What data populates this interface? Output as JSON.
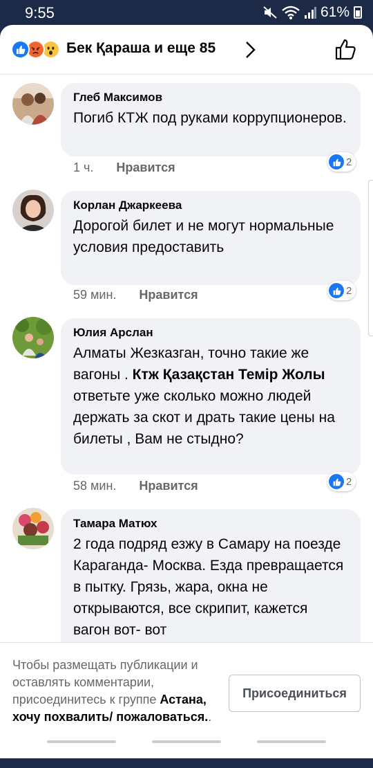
{
  "status_bar": {
    "time": "9:55",
    "battery": "61%",
    "icons": [
      "mute-icon",
      "wifi-icon",
      "signal-icon",
      "battery-icon"
    ]
  },
  "header": {
    "title": "Бек Қараша и еще 85",
    "reactions": [
      "like-reaction-icon",
      "angry-reaction-icon",
      "wow-reaction-icon"
    ]
  },
  "comments": [
    {
      "author": "Глеб Максимов",
      "text": "Погиб КТЖ под руками коррупционеров.",
      "time": "1 ч.",
      "like_label": "Нравится",
      "reaction_count": "2"
    },
    {
      "author": "Корлан Джаркеева",
      "text": "Дорогой билет и не могут нормальные условия предоставить",
      "time": "59 мин.",
      "like_label": "Нравится",
      "reaction_count": "2"
    },
    {
      "author": "Юлия Арслан",
      "text_before": "Алматы Жезказган, точно такие же вагоны . ",
      "mention": "Ктж Қазақстан Темір Жолы",
      "text_after": " ответьте уже сколько можно людей держать за скот и драть такие цены на билеты , Вам не стыдно?",
      "time": "58 мин.",
      "like_label": "Нравится",
      "reaction_count": "2"
    },
    {
      "author": "Тамара Матюх",
      "text": "2 года подряд езжу в Самару на поезде Караганда- Москва. Езда превращается в пытку. Грязь, жара, окна не открываются, все скрипит, кажется вагон вот- вот"
    }
  ],
  "join": {
    "text": "Чтобы размещать публикации и оставлять комментарии, присоединитесь к группе ",
    "group_name": "Астана, хочу похвалить/ пожаловаться.",
    "suffix": ".",
    "button_label": "Присоединиться"
  },
  "colors": {
    "status_bar_bg": "#1c2a48",
    "accent_blue": "#1877f2",
    "bubble_bg": "#f0f2f5",
    "meta_text": "#65676b"
  }
}
